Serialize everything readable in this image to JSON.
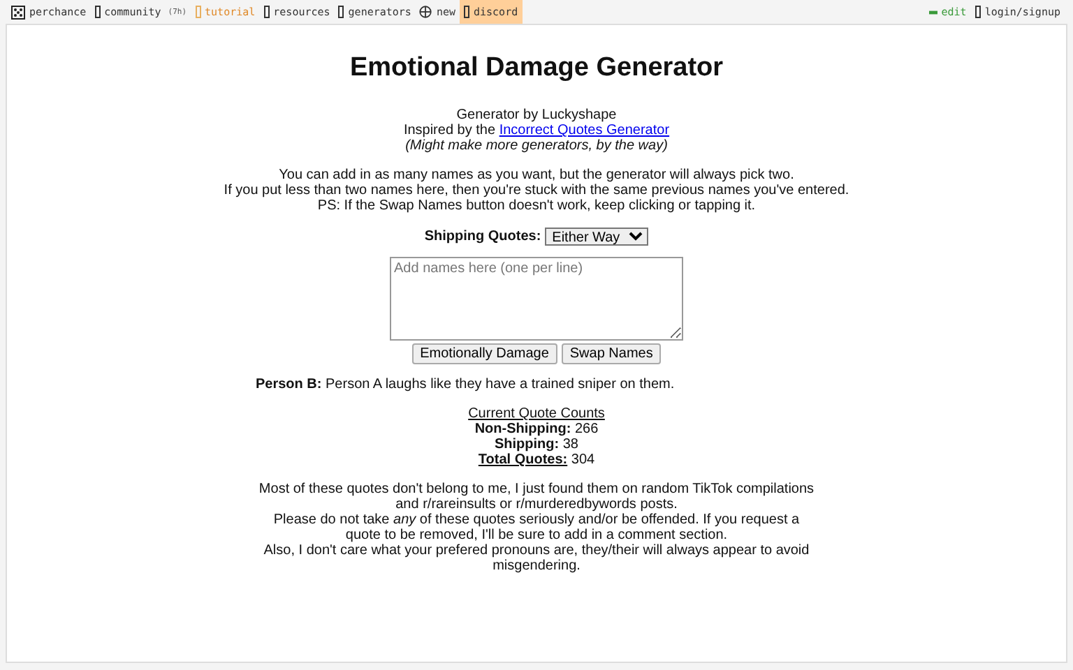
{
  "nav_left": [
    {
      "label": "perchance",
      "kind": "logo"
    },
    {
      "label": "community",
      "badge": "(7h)",
      "kind": "plain"
    },
    {
      "label": "tutorial",
      "kind": "accent"
    },
    {
      "label": "resources",
      "kind": "plain"
    },
    {
      "label": "generators",
      "kind": "plain"
    },
    {
      "label": "new",
      "kind": "globe"
    },
    {
      "label": "discord",
      "kind": "highlight"
    }
  ],
  "nav_right": [
    {
      "label": "edit",
      "kind": "edit"
    },
    {
      "label": "login/signup",
      "kind": "plain"
    }
  ],
  "title": "Emotional Damage Generator",
  "credits": {
    "author_line": "Generator by Luckyshape",
    "inspired_prefix": "Inspired by the",
    "inspired_link": "Incorrect Quotes Generator",
    "aside": "(Might make more generators, by the way)"
  },
  "instructions": [
    "You can add in as many names as you want, but the generator will always pick two.",
    "If you put less than two names here, then you're stuck with the same previous names you've entered.",
    "PS: If the Swap Names button doesn't work, keep clicking or tapping it."
  ],
  "shipping": {
    "label": "Shipping Quotes:",
    "value": "Either Way"
  },
  "names_field": {
    "placeholder": "Add names here (one per line)"
  },
  "buttons": [
    "Emotionally Damage",
    "Swap Names"
  ],
  "result": {
    "speaker": "Person B:",
    "text": "Person A laughs like they have a trained sniper on them."
  },
  "counts": {
    "heading": "Current Quote Counts",
    "items": [
      {
        "label": "Non-Shipping:",
        "value": "266",
        "underlined": false
      },
      {
        "label": "Shipping:",
        "value": "38",
        "underlined": false
      },
      {
        "label": "Total Quotes:",
        "value": "304",
        "underlined": true
      }
    ]
  },
  "notes": [
    "Most of these quotes don't belong to me, I just found them on random TikTok compilations and r/rareinsults or r/murderedbywords posts.",
    "Please do not take *any* of these quotes seriously and/or be offended. If you request a quote to be removed, I'll be sure to add in a comment section.",
    "Also, I don't care what your prefered pronouns are, they/their will always appear to avoid misgendering."
  ]
}
